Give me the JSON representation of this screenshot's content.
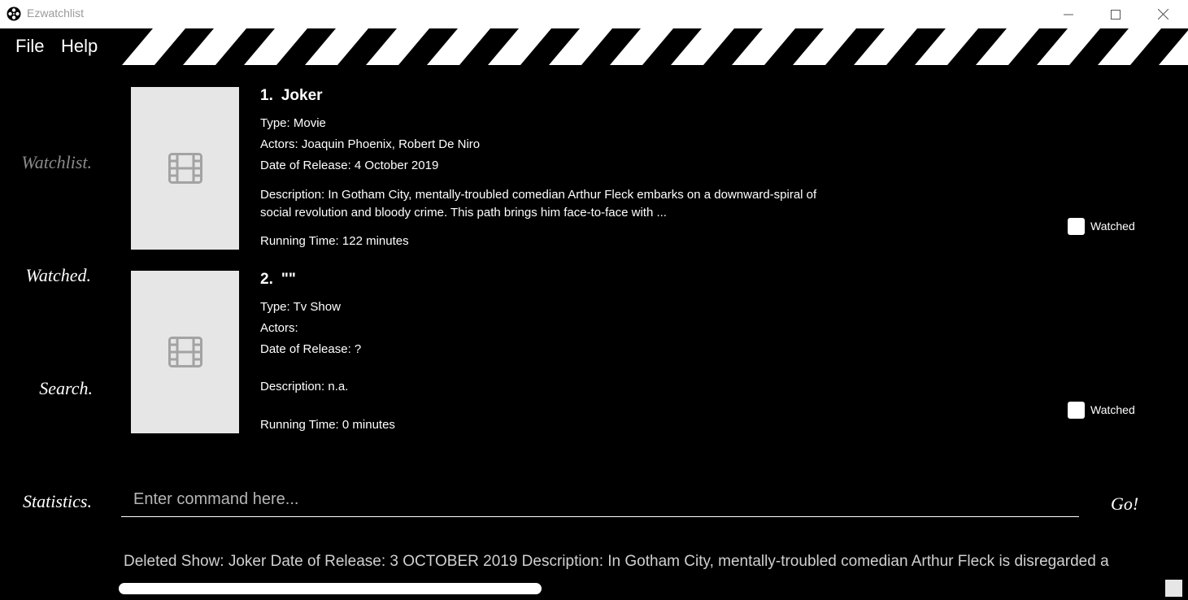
{
  "window": {
    "title": "Ezwatchlist",
    "app_icon": "film-reel-icon",
    "controls": [
      "minimize-icon",
      "maximize-icon",
      "close-icon"
    ]
  },
  "menu": {
    "file_label": "File",
    "help_label": "Help"
  },
  "sidebar": {
    "items": [
      {
        "label": "Watchlist.",
        "active": true
      },
      {
        "label": "Watched.",
        "active": false
      },
      {
        "label": "Search.",
        "active": false
      },
      {
        "label": "Statistics.",
        "active": false
      }
    ]
  },
  "shows": [
    {
      "number": "1.",
      "title": "Joker",
      "type": "Type: Movie",
      "actors": "Actors:   Joaquin Phoenix, Robert De Niro",
      "release": "Date of Release: 4 October 2019",
      "description": "Description: In Gotham City, mentally-troubled comedian Arthur Fleck embarks on a downward-spiral of social revolution and bloody crime. This path brings him face-to-face with ...",
      "running_time": "Running Time: 122 minutes",
      "watched_label": "Watched",
      "watched": false,
      "poster_icon": "film-icon"
    },
    {
      "number": "2.",
      "title": "\"\"",
      "type": "Type: Tv Show",
      "actors": "Actors:",
      "release": "Date of Release: ?",
      "description": "Description: n.a.",
      "running_time": "Running Time: 0 minutes",
      "watched_label": "Watched",
      "watched": false,
      "poster_icon": "film-icon"
    }
  ],
  "command": {
    "placeholder": "Enter command here...",
    "go_label": "Go!"
  },
  "result": {
    "text": "Deleted Show: Joker Date of Release: 3 OCTOBER 2019 Description: In Gotham City, mentally-troubled comedian Arthur Fleck is disregarded a"
  },
  "colors": {
    "background": "#000000",
    "poster_bg": "#e6e6e6",
    "inactive_nav": "#8a8a8a",
    "text": "#ffffff"
  }
}
